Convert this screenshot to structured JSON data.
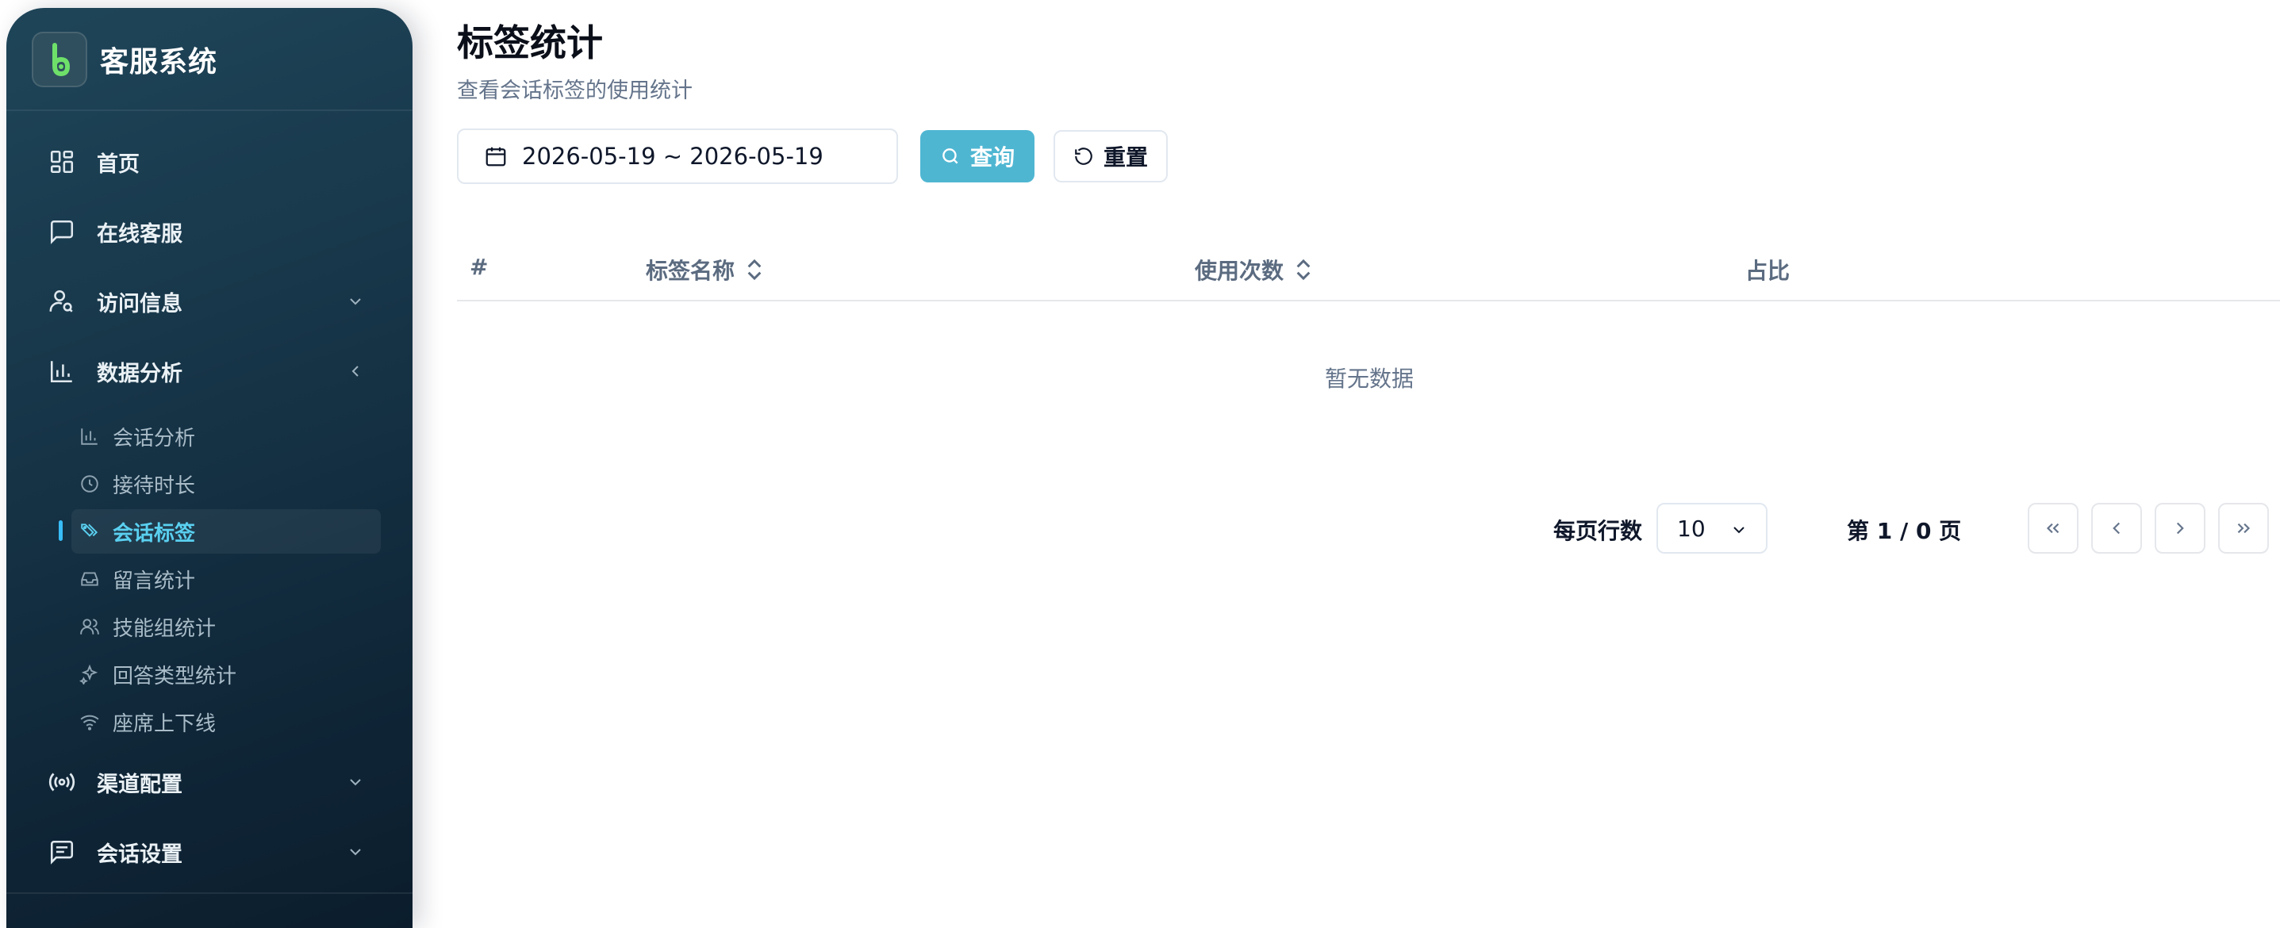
{
  "app": {
    "name": "客服系统",
    "logo_icon": "brand-logo-icon"
  },
  "sidebar": {
    "items": [
      {
        "label": "首页",
        "icon": "dashboard-icon"
      },
      {
        "label": "在线客服",
        "icon": "chat-bubble-icon"
      },
      {
        "label": "访问信息",
        "icon": "user-search-icon",
        "expandable": true
      },
      {
        "label": "数据分析",
        "icon": "bar-chart-icon",
        "expanded": true
      },
      {
        "label": "渠道配置",
        "icon": "broadcast-icon",
        "expandable": true
      },
      {
        "label": "会话设置",
        "icon": "message-square-icon",
        "expandable": true
      }
    ],
    "sub_items": [
      {
        "label": "会话分析",
        "icon": "small-bar-chart-icon"
      },
      {
        "label": "接待时长",
        "icon": "clock-icon"
      },
      {
        "label": "会话标签",
        "icon": "tags-icon",
        "active": true
      },
      {
        "label": "留言统计",
        "icon": "inbox-icon"
      },
      {
        "label": "技能组统计",
        "icon": "users-icon"
      },
      {
        "label": "回答类型统计",
        "icon": "sparkles-icon"
      },
      {
        "label": "座席上下线",
        "icon": "wifi-icon"
      }
    ]
  },
  "page": {
    "title": "标签统计",
    "subtitle": "查看会话标签的使用统计"
  },
  "filters": {
    "date_range": "2026-05-19 ~ 2026-05-19",
    "query_label": "查询",
    "reset_label": "重置"
  },
  "table": {
    "columns": [
      "#",
      "标签名称",
      "使用次数",
      "占比"
    ],
    "empty_text": "暂无数据"
  },
  "pagination": {
    "rows_per_page_label": "每页行数",
    "rows_per_page": "10",
    "page_info": "第 1 / 0 页"
  },
  "colors": {
    "sidebar_bg": "#18374a",
    "accent": "#4fb6d2",
    "active_text": "#5ad0f0"
  }
}
